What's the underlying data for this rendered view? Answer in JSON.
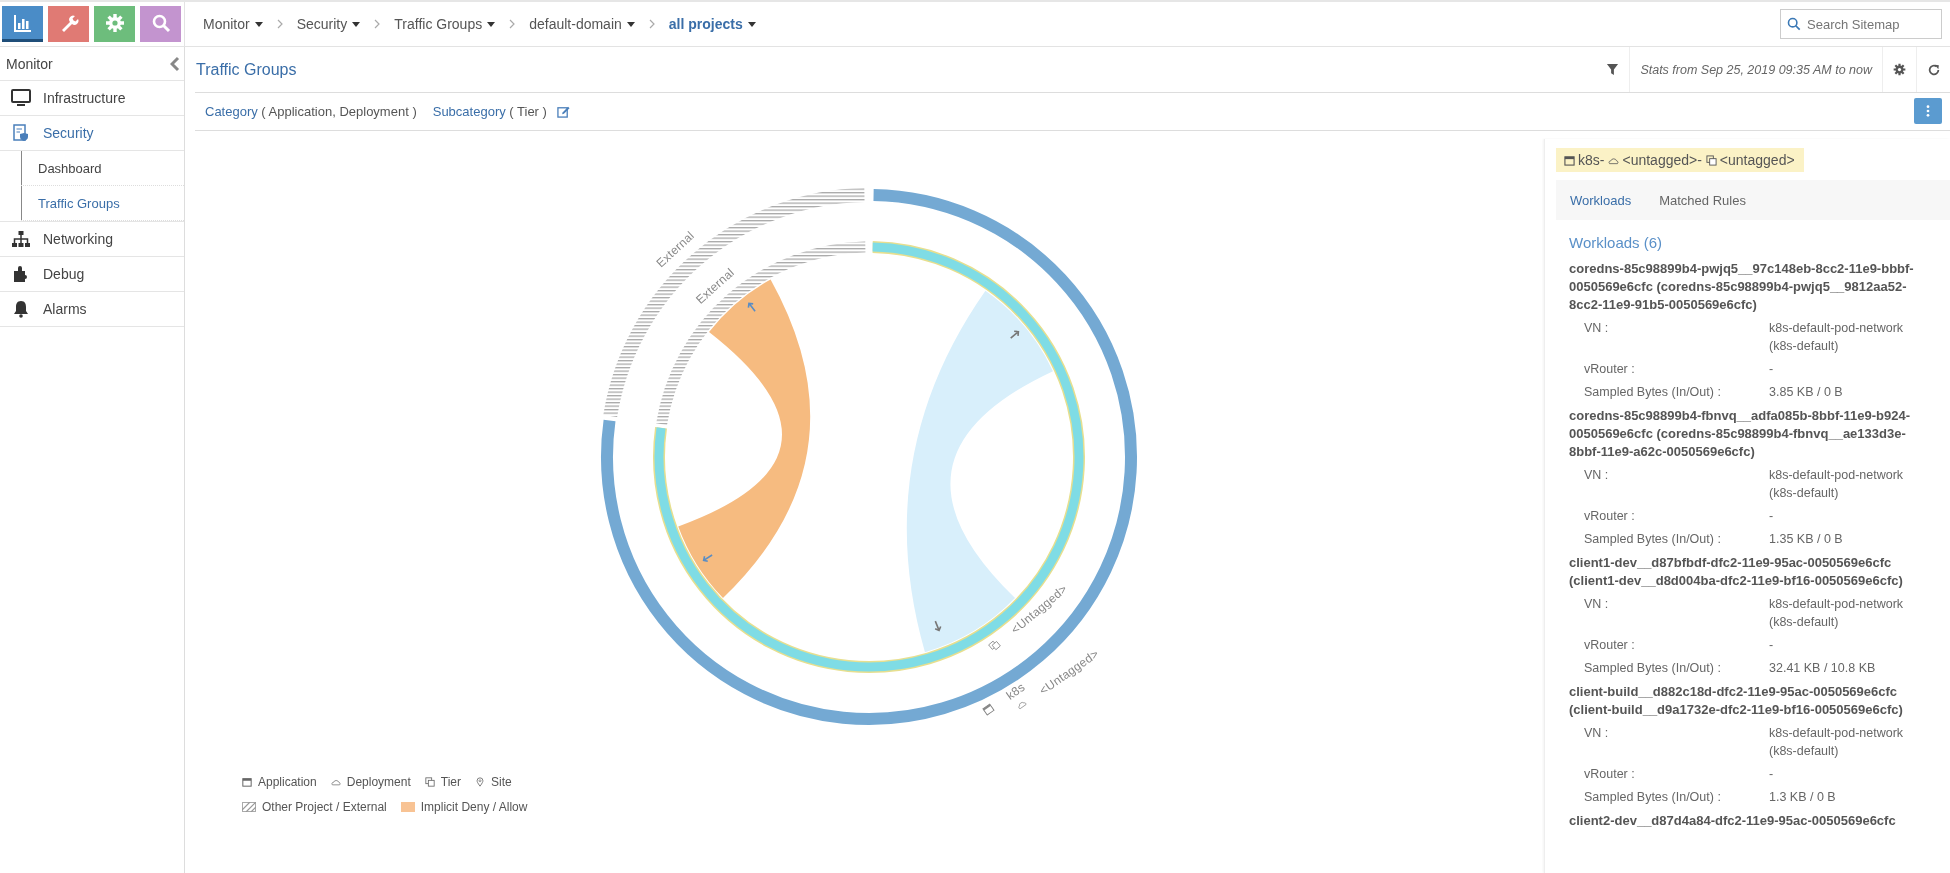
{
  "app_tabs": [
    {
      "kind": "monitor",
      "color": "#4a8cc7",
      "selected": true
    },
    {
      "kind": "configure",
      "color": "#e07a74",
      "selected": false
    },
    {
      "kind": "settings",
      "color": "#6dbd7c",
      "selected": false
    },
    {
      "kind": "query",
      "color": "#c394cf",
      "selected": false
    }
  ],
  "breadcrumb": [
    {
      "label": "Monitor",
      "dropdown": true,
      "current": false
    },
    {
      "label": "Security",
      "dropdown": true,
      "current": false
    },
    {
      "label": "Traffic Groups",
      "dropdown": true,
      "current": false
    },
    {
      "label": "default-domain",
      "dropdown": true,
      "current": false
    },
    {
      "label": "all projects",
      "dropdown": true,
      "current": true
    }
  ],
  "search": {
    "placeholder": "Search Sitemap"
  },
  "sidebar": {
    "title": "Monitor",
    "items": [
      {
        "kind": "infrastructure",
        "label": "Infrastructure",
        "selected": false
      },
      {
        "kind": "security",
        "label": "Security",
        "selected": true,
        "children": [
          {
            "label": "Dashboard",
            "selected": false
          },
          {
            "label": "Traffic Groups",
            "selected": true
          }
        ]
      },
      {
        "kind": "networking",
        "label": "Networking",
        "selected": false
      },
      {
        "kind": "debug",
        "label": "Debug",
        "selected": false
      },
      {
        "kind": "alarms",
        "label": "Alarms",
        "selected": false
      }
    ]
  },
  "page": {
    "title": "Traffic Groups",
    "stats": "Stats from Sep 25, 2019 09:35 AM to now"
  },
  "filters": [
    {
      "label": "Category",
      "value": "( Application, Deployment )"
    },
    {
      "label": "Subcategory",
      "value": "( Tier )"
    }
  ],
  "chart": {
    "rings": [
      {
        "segments": [
          {
            "kind": "external",
            "lines": [
              "External"
            ]
          },
          {
            "kind": "group",
            "lines": [
              "k8s",
              "<Untagged>"
            ]
          }
        ]
      },
      {
        "segments": [
          {
            "kind": "external",
            "lines": [
              "External"
            ]
          },
          {
            "kind": "group",
            "lines": [
              "<Untagged>"
            ]
          }
        ]
      }
    ],
    "chords": [
      {
        "kind": "implicit"
      },
      {
        "kind": "traffic"
      }
    ]
  },
  "legend": [
    [
      {
        "kind": "application",
        "label": "Application"
      },
      {
        "kind": "deployment",
        "label": "Deployment"
      },
      {
        "kind": "tier",
        "label": "Tier"
      },
      {
        "kind": "site",
        "label": "Site"
      }
    ],
    [
      {
        "kind": "external",
        "label": "Other Project / External"
      },
      {
        "kind": "implicit",
        "label": "Implicit Deny / Allow"
      }
    ]
  ],
  "details": {
    "title": [
      "k8s-",
      "<untagged>-",
      "<untagged>"
    ],
    "tabs": [
      {
        "label": "Workloads",
        "selected": true
      },
      {
        "label": "Matched Rules",
        "selected": false
      }
    ],
    "heading": "Workloads (6)",
    "workloads": [
      {
        "name": "coredns-85c98899b4-pwjq5__97c148eb-8cc2-11e9-bbbf-0050569e6cfc (coredns-85c98899b4-pwjq5__9812aa52-8cc2-11e9-91b5-0050569e6cfc)",
        "fields": [
          {
            "label": "VN :",
            "value": "k8s-default-pod-network (k8s-default)"
          },
          {
            "label": "vRouter :",
            "value": "-"
          },
          {
            "label": "Sampled Bytes (In/Out) :",
            "value": "3.85 KB / 0 B"
          }
        ]
      },
      {
        "name": "coredns-85c98899b4-fbnvq__adfa085b-8bbf-11e9-b924-0050569e6cfc (coredns-85c98899b4-fbnvq__ae133d3e-8bbf-11e9-a62c-0050569e6cfc)",
        "fields": [
          {
            "label": "VN :",
            "value": "k8s-default-pod-network (k8s-default)"
          },
          {
            "label": "vRouter :",
            "value": "-"
          },
          {
            "label": "Sampled Bytes (In/Out) :",
            "value": "1.35 KB / 0 B"
          }
        ]
      },
      {
        "name": "client1-dev__d87bfbdf-dfc2-11e9-95ac-0050569e6cfc (client1-dev__d8d004ba-dfc2-11e9-bf16-0050569e6cfc)",
        "fields": [
          {
            "label": "VN :",
            "value": "k8s-default-pod-network (k8s-default)"
          },
          {
            "label": "vRouter :",
            "value": "-"
          },
          {
            "label": "Sampled Bytes (In/Out) :",
            "value": "32.41 KB / 10.8 KB"
          }
        ]
      },
      {
        "name": "client-build__d882c18d-dfc2-11e9-95ac-0050569e6cfc (client-build__d9a1732e-dfc2-11e9-bf16-0050569e6cfc)",
        "fields": [
          {
            "label": "VN :",
            "value": "k8s-default-pod-network (k8s-default)"
          },
          {
            "label": "vRouter :",
            "value": "-"
          },
          {
            "label": "Sampled Bytes (In/Out) :",
            "value": "1.3 KB / 0 B"
          }
        ]
      },
      {
        "name": "client2-dev__d87d4a84-dfc2-11e9-95ac-0050569e6cfc"
      }
    ]
  }
}
